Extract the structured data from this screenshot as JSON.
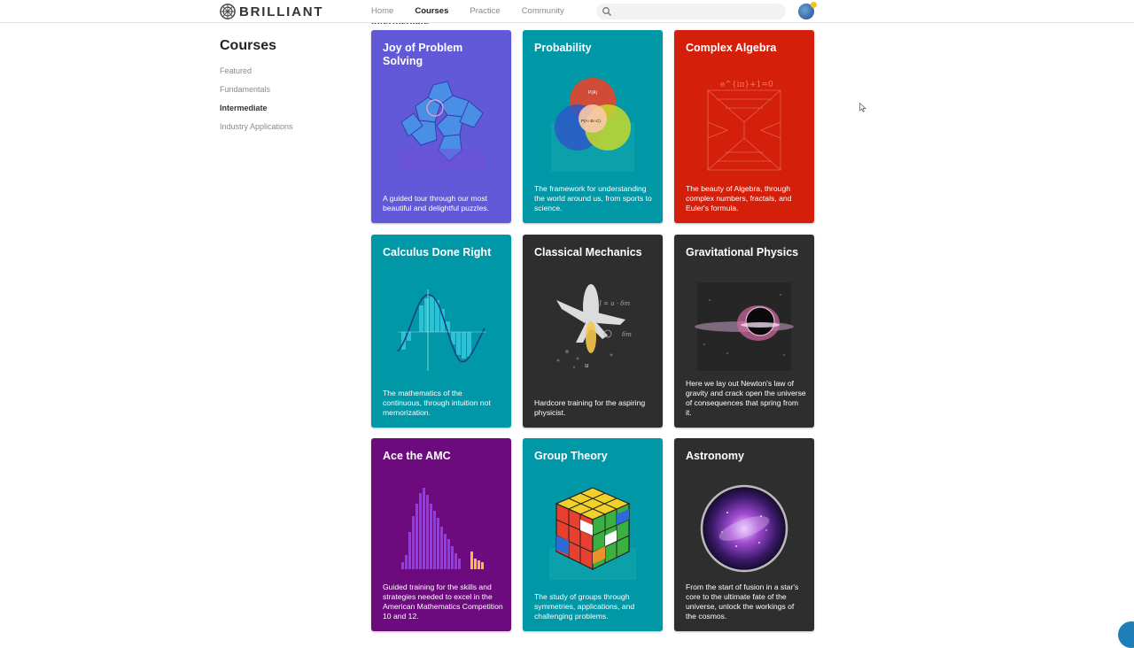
{
  "brand": {
    "name": "BRILLIANT"
  },
  "nav": {
    "items": [
      {
        "label": "Home",
        "active": false
      },
      {
        "label": "Courses",
        "active": true
      },
      {
        "label": "Practice",
        "active": false
      },
      {
        "label": "Community",
        "active": false
      }
    ]
  },
  "search": {
    "placeholder": "",
    "value": ""
  },
  "section_peek": "Intermediate",
  "sidebar": {
    "title": "Courses",
    "items": [
      {
        "label": "Featured",
        "active": false
      },
      {
        "label": "Fundamentals",
        "active": false
      },
      {
        "label": "Intermediate",
        "active": true
      },
      {
        "label": "Industry Applications",
        "active": false
      }
    ]
  },
  "colors": {
    "purple": "#6259d8",
    "teal": "#0097a7",
    "red": "#d41f0a",
    "dark": "#2e2e2e",
    "violet": "#6d0a7e"
  },
  "cards": [
    {
      "title": "Joy of Problem Solving",
      "desc": "A guided tour through our most beautiful and delightful puzzles.",
      "color": "#6259d8"
    },
    {
      "title": "Probability",
      "desc": "The framework for understanding the world around us, from sports to science.",
      "color": "#0097a7"
    },
    {
      "title": "Complex Algebra",
      "desc": "The beauty of Algebra, through complex numbers, fractals, and Euler's formula.",
      "color": "#d41f0a"
    },
    {
      "title": "Calculus Done Right",
      "desc": "The mathematics of the continuous, through intuition not memorization.",
      "color": "#0097a7"
    },
    {
      "title": "Classical Mechanics",
      "desc": "Hardcore training for the aspiring physicist.",
      "color": "#2e2e2e"
    },
    {
      "title": "Gravitational Physics",
      "desc": "Here we lay out Newton's law of gravity and crack open the universe of consequences that spring from it.",
      "color": "#2e2e2e"
    },
    {
      "title": "Ace the AMC",
      "desc": "Guided training for the skills and strategies needed to excel in the American Mathematics Competition 10 and 12.",
      "color": "#6d0a7e"
    },
    {
      "title": "Group Theory",
      "desc": "The study of groups through symmetries, applications, and challenging problems.",
      "color": "#0097a7"
    },
    {
      "title": "Astronomy",
      "desc": "From the start of fusion in a star's core to the ultimate fate of the universe, unlock the workings of the cosmos.",
      "color": "#2e2e2e"
    }
  ],
  "art_text": {
    "euler": "e^{iπ}+1=0",
    "venn_a": "P(A)",
    "venn_abc": "P(A∩B∩C)",
    "mech_j": "J = u · δm",
    "mech_dm": "δm",
    "mech_u": "u"
  }
}
